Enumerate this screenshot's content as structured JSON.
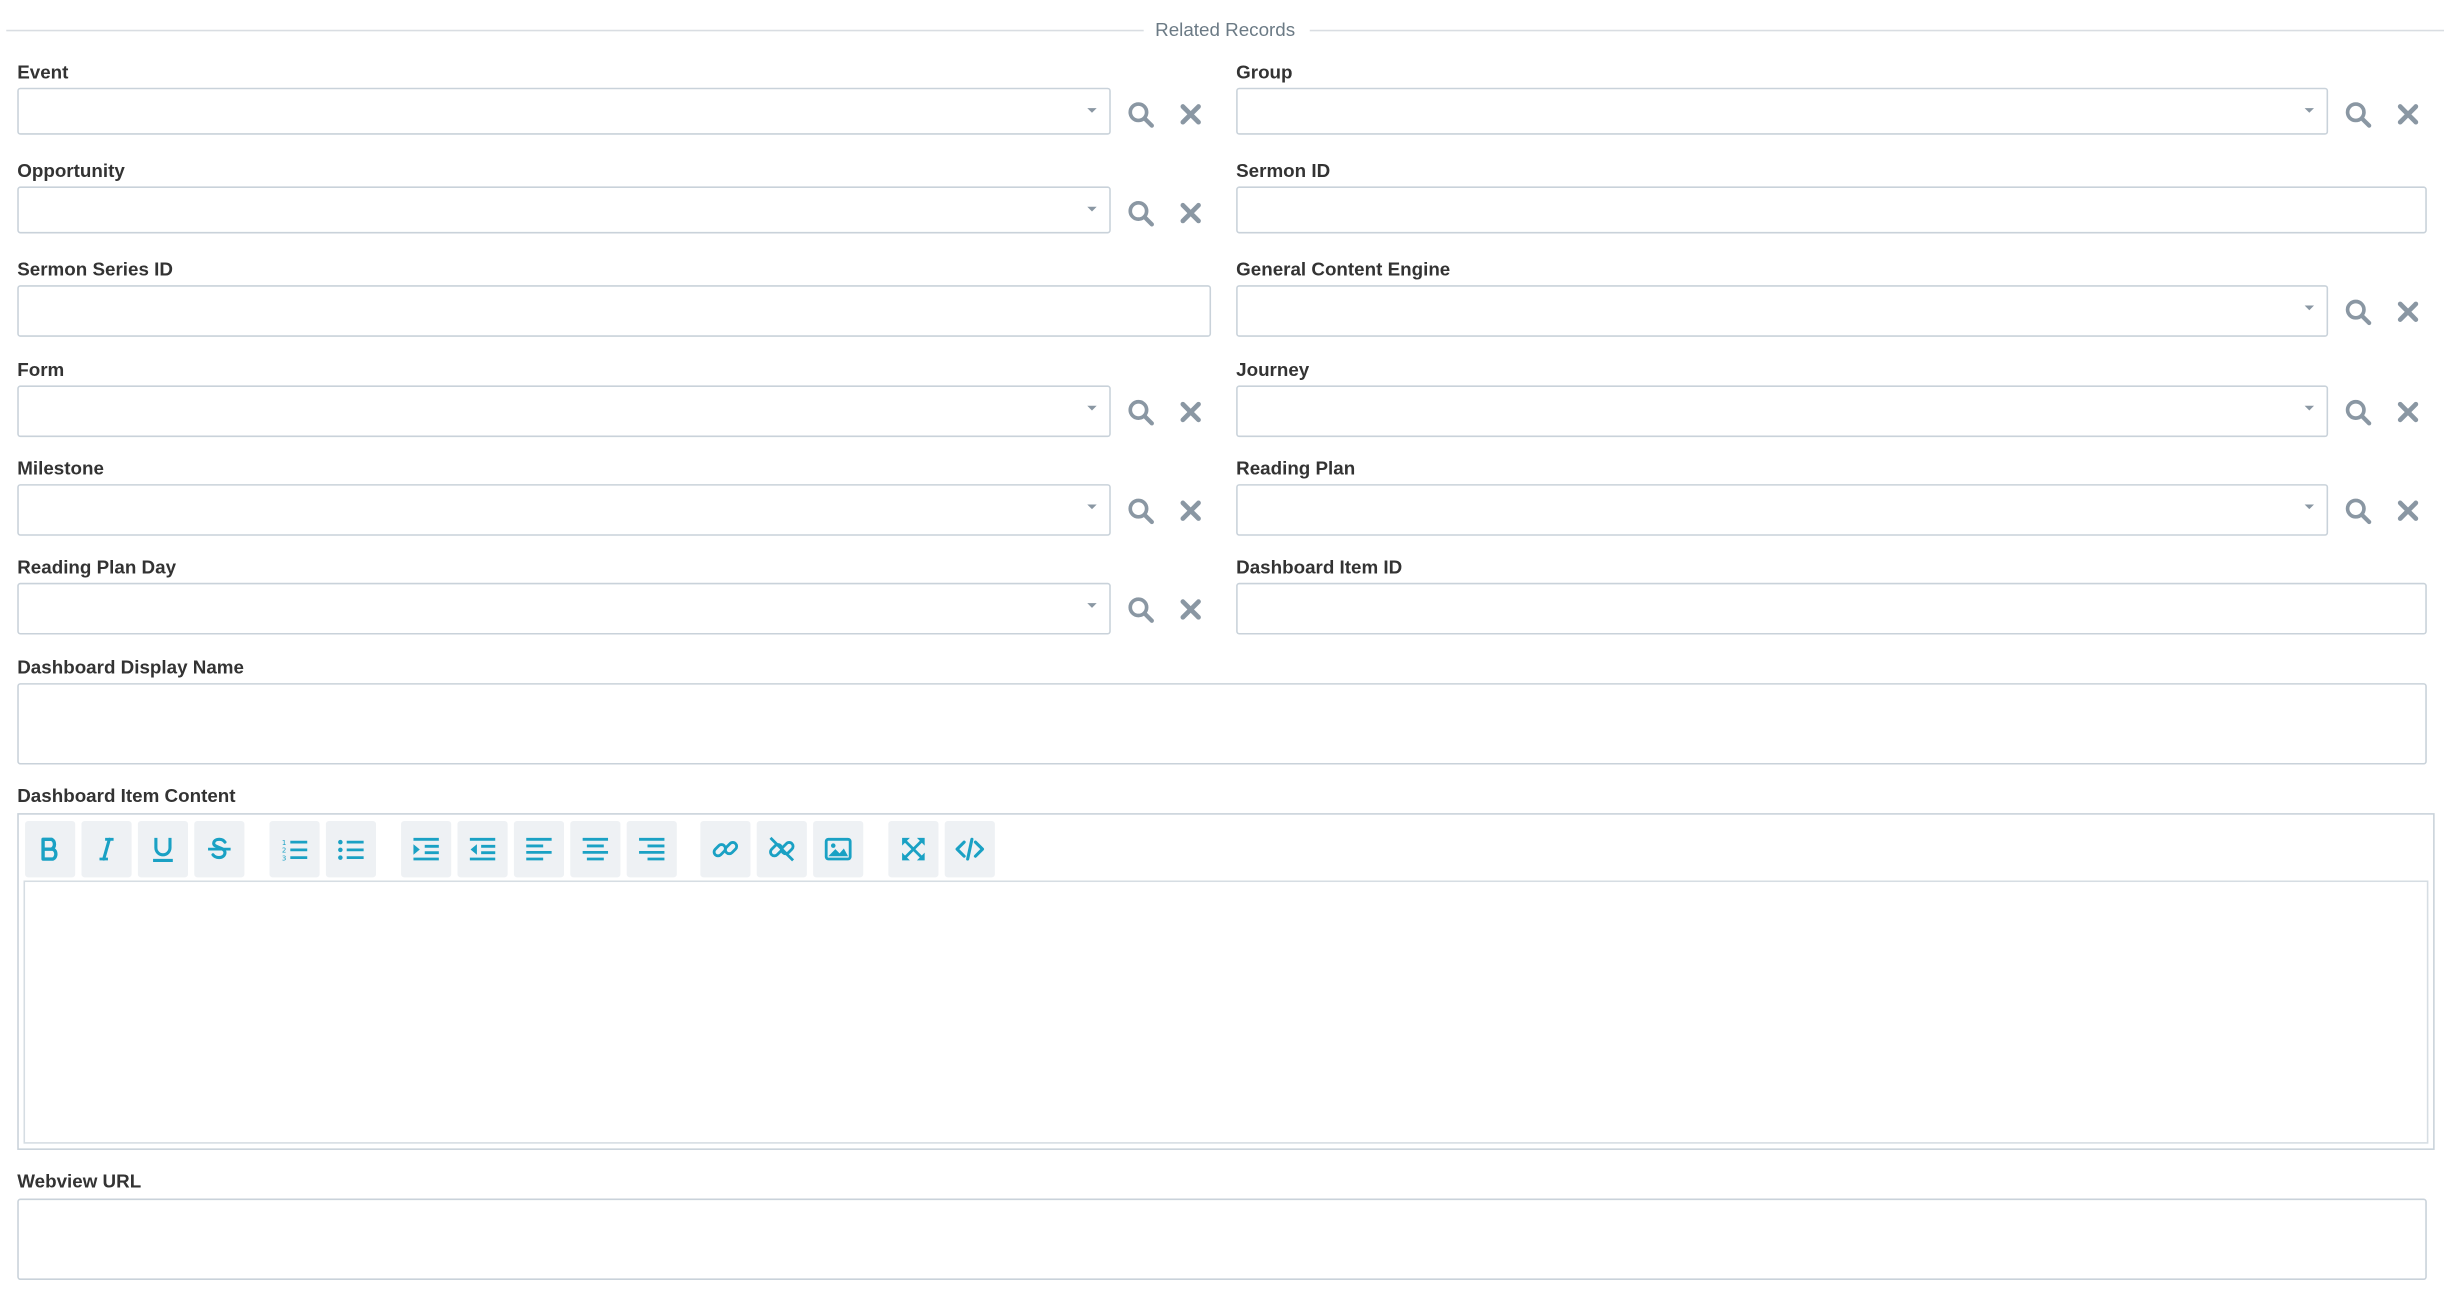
{
  "section": {
    "title": "Related Records"
  },
  "fields": {
    "event": {
      "label": "Event",
      "value": ""
    },
    "group": {
      "label": "Group",
      "value": ""
    },
    "opportunity": {
      "label": "Opportunity",
      "value": ""
    },
    "sermon_id": {
      "label": "Sermon ID",
      "value": ""
    },
    "sermon_series_id": {
      "label": "Sermon Series ID",
      "value": ""
    },
    "general_content_engine": {
      "label": "General Content Engine",
      "value": ""
    },
    "form": {
      "label": "Form",
      "value": ""
    },
    "journey": {
      "label": "Journey",
      "value": ""
    },
    "milestone": {
      "label": "Milestone",
      "value": ""
    },
    "reading_plan": {
      "label": "Reading Plan",
      "value": ""
    },
    "reading_plan_day": {
      "label": "Reading Plan Day",
      "value": ""
    },
    "dashboard_item_id": {
      "label": "Dashboard Item ID",
      "value": ""
    },
    "dashboard_display_name": {
      "label": "Dashboard Display Name",
      "value": ""
    },
    "dashboard_item_content": {
      "label": "Dashboard Item Content",
      "value": ""
    },
    "webview_url": {
      "label": "Webview URL",
      "value": ""
    }
  },
  "icons": {
    "lookup": "search-icon",
    "clear": "close-icon",
    "toolbar": [
      "bold-icon",
      "italic-icon",
      "underline-icon",
      "strikethrough-icon",
      "ordered-list-icon",
      "unordered-list-icon",
      "indent-icon",
      "outdent-icon",
      "align-left-icon",
      "align-center-icon",
      "align-right-icon",
      "link-icon",
      "unlink-icon",
      "image-icon",
      "fullscreen-icon",
      "code-view-icon"
    ]
  },
  "colors": {
    "label": "#333333",
    "border": "#c9d2da",
    "action_icon": "#8a97a3",
    "toolbar_icon": "#1aa1c4",
    "toolbar_button_bg": "#eef1f4"
  }
}
